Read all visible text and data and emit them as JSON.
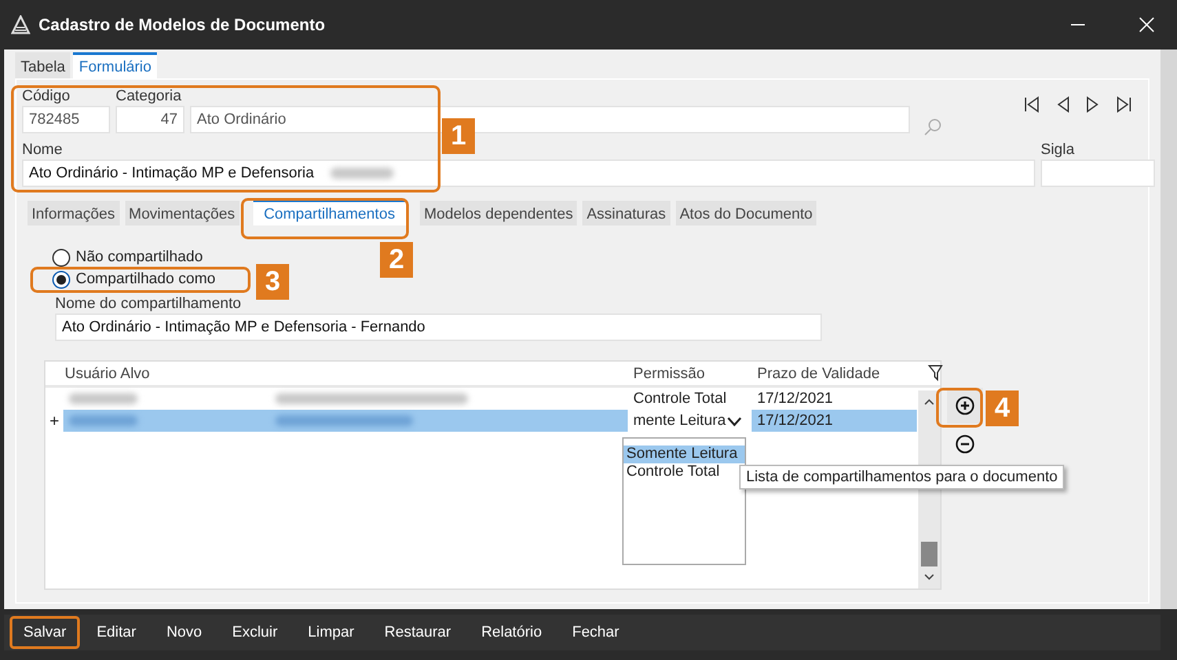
{
  "window": {
    "title": "Cadastro de Modelos de Documento"
  },
  "view_tabs": [
    {
      "label": "Tabela",
      "selected": false
    },
    {
      "label": "Formulário",
      "selected": true
    }
  ],
  "form": {
    "codigo": {
      "label": "Código",
      "value": "782485"
    },
    "categoria": {
      "label": "Categoria",
      "code": "47",
      "value": "Ato Ordinário"
    },
    "nome": {
      "label": "Nome",
      "value": "Ato Ordinário - Intimação MP e Defensoria"
    },
    "sigla": {
      "label": "Sigla"
    }
  },
  "section_tabs": [
    {
      "label": "Informações",
      "selected": false
    },
    {
      "label": "Movimentações",
      "selected": false
    },
    {
      "label": "Compartilhamentos",
      "selected": true
    },
    {
      "label": "Modelos dependentes",
      "selected": false
    },
    {
      "label": "Assinaturas",
      "selected": false
    },
    {
      "label": "Atos do Documento",
      "selected": false
    }
  ],
  "sharing_options": [
    {
      "label": "Não compartilhado",
      "selected": false
    },
    {
      "label": "Compartilhado como",
      "selected": true
    }
  ],
  "share_name": {
    "label": "Nome do compartilhamento",
    "value": "Ato Ordinário - Intimação MP e Defensoria - Fernando"
  },
  "table": {
    "columns": [
      "Usuário Alvo",
      "Permissão",
      "Prazo de Validade"
    ],
    "rows": [
      {
        "marker": "",
        "permission": "Controle Total",
        "expiry": "17/12/2021",
        "selected": false
      },
      {
        "marker": "+",
        "permission": "mente Leitura",
        "expiry": "17/12/2021",
        "selected": true
      }
    ]
  },
  "permission_options": [
    {
      "label": "Somente Leitura",
      "selected": true
    },
    {
      "label": "Controle Total",
      "selected": false
    }
  ],
  "tooltip": "Lista de compartilhamentos para o documento",
  "toolbar": [
    {
      "label": "Salvar",
      "highlighted": true
    },
    {
      "label": "Editar",
      "highlighted": false
    },
    {
      "label": "Novo",
      "highlighted": false
    },
    {
      "label": "Excluir",
      "highlighted": false
    },
    {
      "label": "Limpar",
      "highlighted": false
    },
    {
      "label": "Restaurar",
      "highlighted": false
    },
    {
      "label": "Relatório",
      "highlighted": false
    },
    {
      "label": "Fechar",
      "highlighted": false
    }
  ],
  "callouts": [
    "1",
    "2",
    "3",
    "4"
  ]
}
